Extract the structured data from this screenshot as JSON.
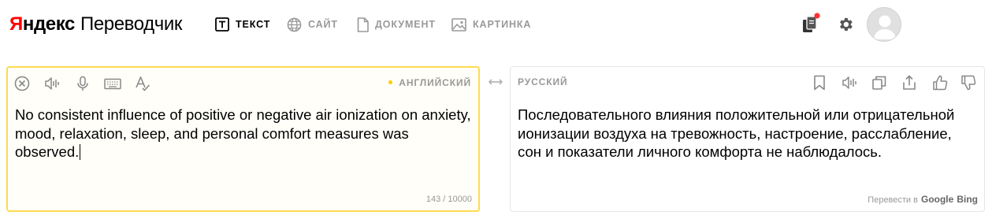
{
  "header": {
    "logo": {
      "ya_red": "Я",
      "ya_black": "ндекс",
      "product": "Переводчик"
    },
    "modes": [
      {
        "label": "ТЕКСТ",
        "icon": "text-mode-icon",
        "active": true
      },
      {
        "label": "САЙТ",
        "icon": "globe-icon",
        "active": false
      },
      {
        "label": "ДОКУМЕНТ",
        "icon": "document-icon",
        "active": false
      },
      {
        "label": "КАРТИНКА",
        "icon": "image-icon",
        "active": false
      }
    ],
    "right_icons": [
      "collections-icon",
      "settings-gear-icon",
      "user-avatar"
    ],
    "notification_dot_color": "#ff3333"
  },
  "source": {
    "tool_icons": [
      "clear-icon",
      "speaker-icon",
      "microphone-icon",
      "keyboard-icon",
      "spellcheck-icon"
    ],
    "language": "АНГЛИЙСКИЙ",
    "text": "No consistent influence of positive or negative air ionization on anxiety, mood, relaxation, sleep, and personal comfort measures was observed.",
    "counter": "143 / 10000",
    "border_color": "#ffdb4d"
  },
  "swap_icon": "swap-arrows-icon",
  "target": {
    "language": "РУССКИЙ",
    "tool_icons": [
      "bookmark-icon",
      "speaker-icon",
      "copy-icon",
      "share-icon",
      "thumbs-up-icon",
      "thumbs-down-icon"
    ],
    "text": "Последовательного влияния положительной или отрицательной ионизации воздуха на тревожность, настроение, расслабление, сон и показатели личного комфорта не наблюдалось.",
    "engines_label": "Перевести в",
    "engines": [
      "Google",
      "Bing"
    ]
  }
}
